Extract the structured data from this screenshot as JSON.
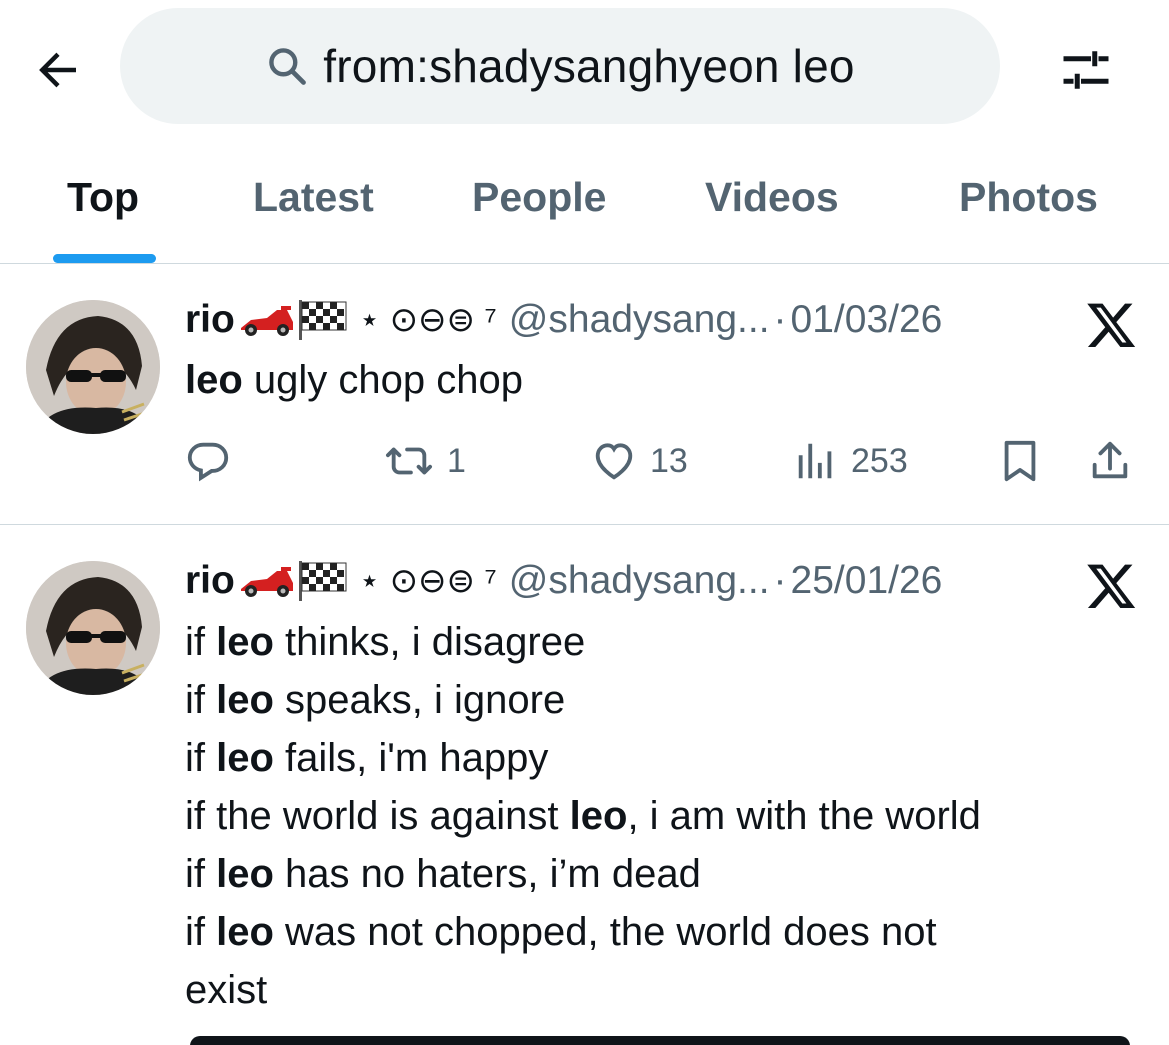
{
  "search": {
    "query": "from:shadysanghyeon leo",
    "back_icon": "arrow-left-icon",
    "search_icon": "search-icon",
    "filter_icon": "sliders-icon"
  },
  "tabs": [
    {
      "label": "Top",
      "active": true
    },
    {
      "label": "Latest",
      "active": false
    },
    {
      "label": "People",
      "active": false
    },
    {
      "label": "Videos",
      "active": false
    },
    {
      "label": "Photos",
      "active": false
    }
  ],
  "accent_color": "#1d9bf0",
  "tweets": [
    {
      "display_name": "rio",
      "name_emoji": "🏎️🏁",
      "name_suffix": "⋆ ⊙⊖⊜ ⁷",
      "handle": "@shadysang...",
      "separator": "·",
      "date": "01/03/26",
      "text_lines": [
        [
          {
            "t": "leo",
            "b": true
          },
          {
            "t": " ugly chop chop",
            "b": false
          }
        ]
      ],
      "replies": "",
      "retweets": "1",
      "likes": "13",
      "views": "253"
    },
    {
      "display_name": "rio",
      "name_emoji": "🏎️🏁",
      "name_suffix": "⋆ ⊙⊖⊜ ⁷",
      "handle": "@shadysang...",
      "separator": "·",
      "date": "25/01/26",
      "text_lines": [
        [
          {
            "t": "if ",
            "b": false
          },
          {
            "t": "leo",
            "b": true
          },
          {
            "t": " thinks, i disagree",
            "b": false
          }
        ],
        [
          {
            "t": "if ",
            "b": false
          },
          {
            "t": "leo",
            "b": true
          },
          {
            "t": " speaks, i ignore",
            "b": false
          }
        ],
        [
          {
            "t": "if ",
            "b": false
          },
          {
            "t": "leo",
            "b": true
          },
          {
            "t": " fails, i'm happy",
            "b": false
          }
        ],
        [
          {
            "t": "if the world is against ",
            "b": false
          },
          {
            "t": "leo",
            "b": true
          },
          {
            "t": ", i am with the world",
            "b": false
          }
        ],
        [
          {
            "t": "if ",
            "b": false
          },
          {
            "t": "leo",
            "b": true
          },
          {
            "t": " has no haters, i’m dead",
            "b": false
          }
        ],
        [
          {
            "t": "if ",
            "b": false
          },
          {
            "t": "leo",
            "b": true
          },
          {
            "t": " was not chopped, the world does not",
            "b": false
          }
        ],
        [
          {
            "t": "exist",
            "b": false
          }
        ]
      ]
    }
  ]
}
